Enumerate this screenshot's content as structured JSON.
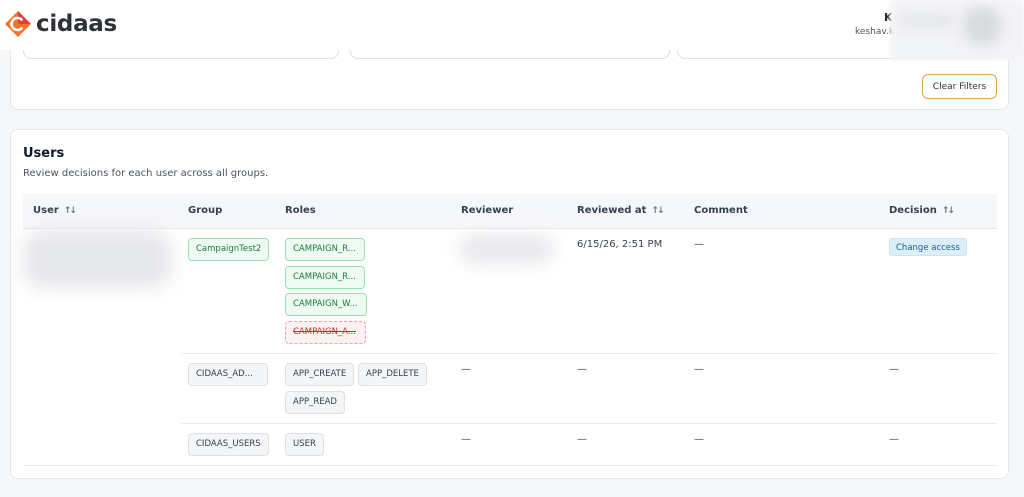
{
  "header": {
    "logo_text": "cidaas",
    "user_initial": "K",
    "user_email": "keshav.k"
  },
  "filters": {
    "clear_label": "Clear Filters"
  },
  "users": {
    "title": "Users",
    "subtitle": "Review decisions for each user across all groups.",
    "columns": {
      "user": "User",
      "group": "Group",
      "roles": "Roles",
      "reviewer": "Reviewer",
      "reviewed_at": "Reviewed at",
      "comment": "Comment",
      "decision": "Decision"
    },
    "sort_icon": "↑↓",
    "rows": [
      {
        "group": "CampaignTest2",
        "roles": [
          {
            "label": "CAMPAIGN_R...",
            "status": "kept"
          },
          {
            "label": "CAMPAIGN_R...",
            "status": "kept"
          },
          {
            "label": "CAMPAIGN_W...",
            "status": "kept"
          },
          {
            "label": "CAMPAIGN_A...",
            "status": "removed"
          }
        ],
        "reviewed_at": "6/15/26, 2:51 PM",
        "comment": "—",
        "decision": "Change access"
      },
      {
        "group": "CIDAAS_AD...",
        "roles": [
          {
            "label": "APP_CREATE"
          },
          {
            "label": "APP_DELETE"
          },
          {
            "label": "APP_READ"
          }
        ],
        "reviewer": "—",
        "reviewed_at": "—",
        "comment": "—",
        "decision": "—"
      },
      {
        "group": "CIDAAS_USERS",
        "roles": [
          {
            "label": "USER"
          }
        ],
        "reviewer": "—",
        "reviewed_at": "—",
        "comment": "—",
        "decision": "—"
      }
    ]
  },
  "colors": {
    "brand_orange": "#f0772a",
    "accent_red": "#e2403d",
    "clear_border": "#e0a15a",
    "kept_green": "#1f7a3d",
    "removed_red": "#c2302f"
  }
}
